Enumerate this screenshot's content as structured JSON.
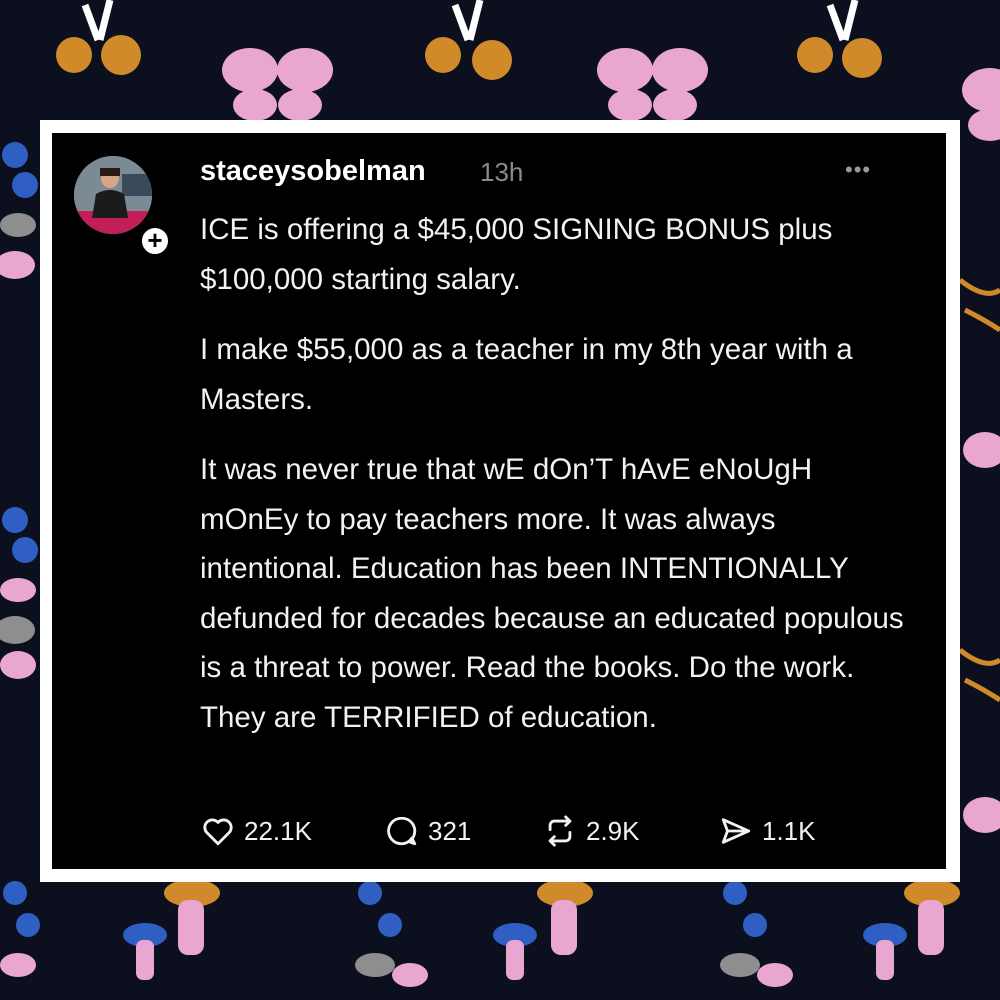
{
  "post": {
    "username": "staceysobelman",
    "time_ago": "13h",
    "more_label": "•••",
    "paragraphs": [
      "ICE is offering a $45,000 SIGNING BONUS plus $100,000 starting salary.",
      "I make $55,000 as a teacher in my 8th year with a Masters.",
      "It was never true that wE dOn’T hAvE eNoUgH mOnEy to pay teachers more. It was always intentional. Education has been INTENTIONALLY defunded for decades because an educated populous is a threat to power. Read the books. Do the work. They are TERRIFIED of education."
    ]
  },
  "actions": {
    "likes": "22.1K",
    "replies": "321",
    "reposts": "2.9K",
    "shares": "1.1K"
  },
  "icons": {
    "like": "heart-icon",
    "reply": "speech-bubble-icon",
    "repost": "repost-arrows-icon",
    "share": "send-arrow-icon",
    "follow": "plus-icon",
    "more": "more-dots-icon"
  },
  "colors": {
    "background": "#0b0f1e",
    "card": "#000000",
    "frame": "#ffffff",
    "pattern_pink": "#e8a6d0",
    "pattern_gold": "#d08a2a",
    "pattern_blue": "#2f5fc2",
    "pattern_gray": "#8e8e8e"
  }
}
